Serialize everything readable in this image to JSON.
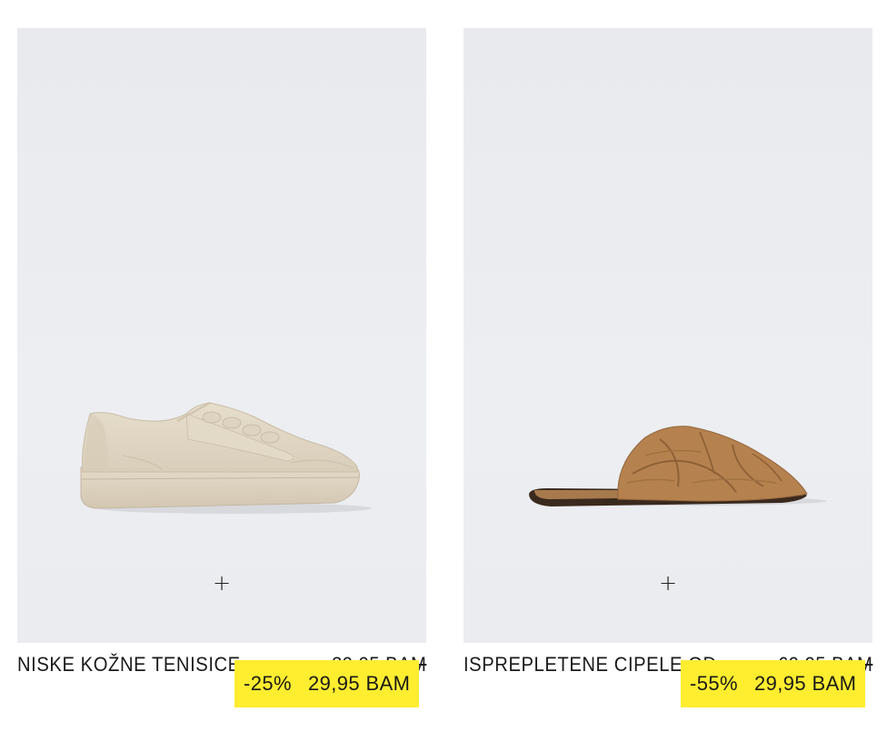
{
  "products": [
    {
      "name": "NISKE KOŽNE TENISICE",
      "old_price": "39,95 BAM",
      "discount": "-25%",
      "sale_price": "29,95 BAM",
      "add_icon": "plus-icon",
      "image": "beige-leather-sneaker",
      "colors": {
        "product": "#ddd3c0",
        "badge": "#ffed2f"
      }
    },
    {
      "name": "ISPREPLETENE CIPELE OD ...",
      "old_price": "69,95 BAM",
      "discount": "-55%",
      "sale_price": "29,95 BAM",
      "add_icon": "plus-icon",
      "image": "tan-woven-mule",
      "colors": {
        "product": "#b5824f",
        "badge": "#ffed2f"
      }
    }
  ],
  "add_symbol": "+"
}
